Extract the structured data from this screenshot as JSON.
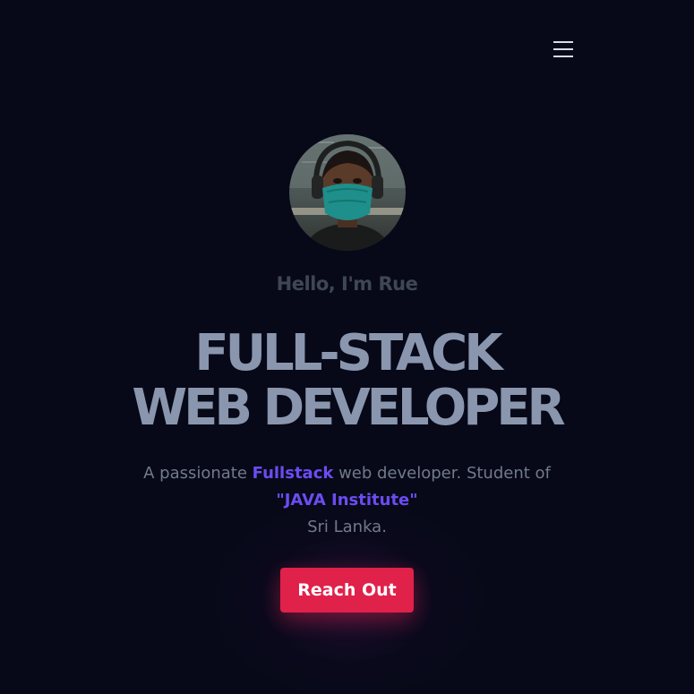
{
  "nav": {
    "menu_icon": "hamburger-menu-icon"
  },
  "hero": {
    "avatar_alt": "profile photo",
    "greeting": "Hello, I'm Rue",
    "headline_line1": "FULL-STACK",
    "headline_line2": "WEB DEVELOPER",
    "intro_prefix": "A passionate ",
    "intro_highlight": "Fullstack",
    "intro_suffix": " web developer.   Student of",
    "institute": "\"JAVA Institute\"",
    "country": "Sri Lanka.",
    "cta_label": "Reach Out"
  },
  "colors": {
    "background": "#070918",
    "headline": "#8a96ae",
    "accent": "#6c4cf2",
    "cta": "#e0214a"
  }
}
